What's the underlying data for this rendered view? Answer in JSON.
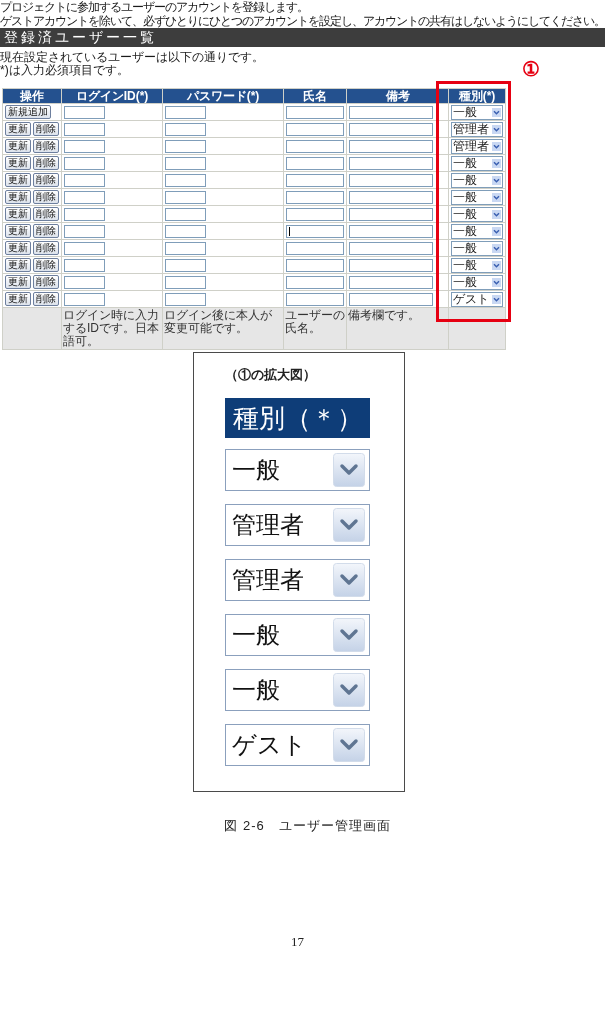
{
  "intro": {
    "lines": [
      "プロジェクトに参加するユーザーのアカウントを登録します。",
      "ゲストアカウントを除いて、必ずひとりにひとつのアカウントを設定し、アカウントの共有はしないようにしてください。"
    ]
  },
  "section": {
    "title": "登録済ユーザー一覧"
  },
  "notes": [
    "現在設定されているユーザーは以下の通りです。",
    "*)は入力必須項目です。"
  ],
  "callout": {
    "label": "①"
  },
  "table": {
    "columns": [
      "操作",
      "ログインID(*)",
      "パスワード(*)",
      "氏名",
      "備考",
      "種別(*)"
    ],
    "rows": [
      {
        "actions": [
          "新規追加"
        ],
        "name_caret": false,
        "type": "一般"
      },
      {
        "actions": [
          "更新",
          "削除"
        ],
        "name_caret": false,
        "type": "管理者"
      },
      {
        "actions": [
          "更新",
          "削除"
        ],
        "name_caret": false,
        "type": "管理者"
      },
      {
        "actions": [
          "更新",
          "削除"
        ],
        "name_caret": false,
        "type": "一般"
      },
      {
        "actions": [
          "更新",
          "削除"
        ],
        "name_caret": false,
        "type": "一般"
      },
      {
        "actions": [
          "更新",
          "削除"
        ],
        "name_caret": false,
        "type": "一般"
      },
      {
        "actions": [
          "更新",
          "削除"
        ],
        "name_caret": false,
        "type": "一般"
      },
      {
        "actions": [
          "更新",
          "削除"
        ],
        "name_caret": true,
        "type": "一般"
      },
      {
        "actions": [
          "更新",
          "削除"
        ],
        "name_caret": false,
        "type": "一般"
      },
      {
        "actions": [
          "更新",
          "削除"
        ],
        "name_caret": false,
        "type": "一般"
      },
      {
        "actions": [
          "更新",
          "削除"
        ],
        "name_caret": false,
        "type": "一般"
      },
      {
        "actions": [
          "更新",
          "削除"
        ],
        "name_caret": false,
        "type": "ゲスト"
      }
    ],
    "footer": {
      "login_id": "ログイン時に入力するIDです。日本語可。",
      "password": "ログイン後に本人が変更可能です。",
      "name": "ユーザーの氏名。",
      "note": "備考欄です。"
    }
  },
  "figure": {
    "caption": "（①の拡大図）",
    "header": "種別（＊）",
    "selects": [
      "一般",
      "管理者",
      "管理者",
      "一般",
      "一般",
      "ゲスト"
    ]
  },
  "figure_caption": "図 2-6　ユーザー管理画面",
  "page_number": "17"
}
